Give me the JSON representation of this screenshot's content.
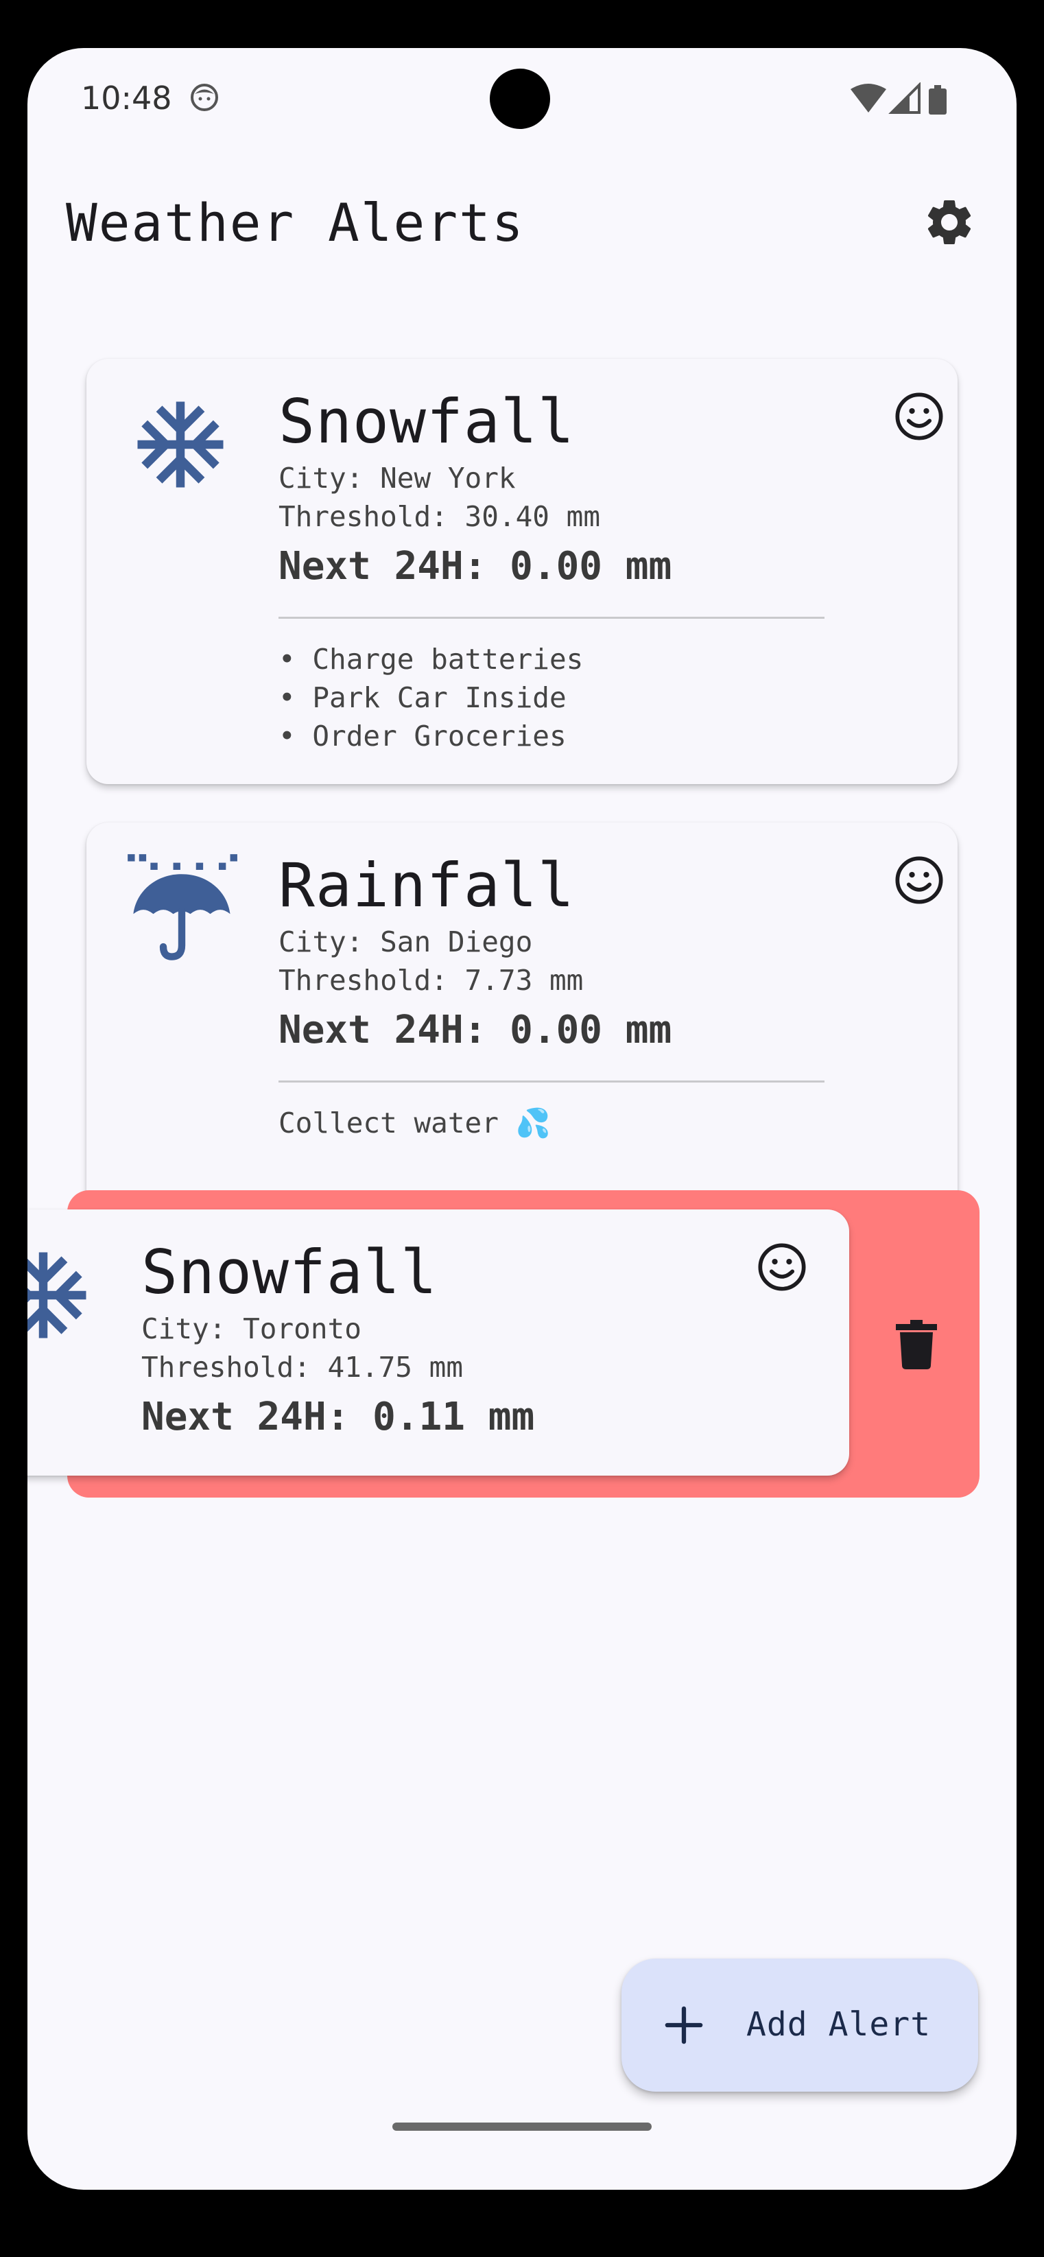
{
  "status_bar": {
    "time": "10:48",
    "icons": [
      "face-icon",
      "wifi-icon",
      "signal-icon",
      "battery-icon"
    ]
  },
  "app_bar": {
    "title": "Weather Alerts",
    "settings_icon": "gear-icon"
  },
  "alerts": [
    {
      "type": "Snowfall",
      "icon": "snowflake-icon",
      "city": "City: New York",
      "threshold": "Threshold: 30.40 mm",
      "next24": "Next 24H: 0.00 mm",
      "status_icon": "smiley-icon",
      "notes": [
        "Charge batteries",
        "Park Car Inside",
        "Order Groceries"
      ]
    },
    {
      "type": "Rainfall",
      "icon": "umbrella-rain-icon",
      "city": "City: San Diego",
      "threshold": "Threshold: 7.73 mm",
      "next24": "Next 24H: 0.00 mm",
      "status_icon": "smiley-icon",
      "note": "Collect water 💦"
    },
    {
      "type": "Snowfall",
      "icon": "snowflake-icon",
      "city": "City: Toronto",
      "threshold": "Threshold: 41.75 mm",
      "next24": "Next 24H: 0.11 mm",
      "status_icon": "smiley-icon",
      "swipe_action_icon": "trash-icon"
    }
  ],
  "fab": {
    "label": "Add Alert",
    "icon": "plus-icon"
  },
  "colors": {
    "background": "#f9f8fd",
    "card": "#f8f7fc",
    "icon_blue": "#3f5f97",
    "swipe_delete": "#ff7b7b",
    "fab": "#dbe2fa"
  }
}
